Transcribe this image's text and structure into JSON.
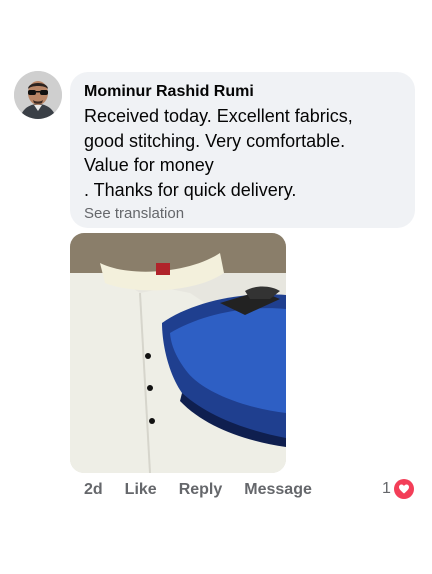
{
  "comment": {
    "author": "Mominur Rashid Rumi",
    "text_lines": [
      "Received today. Excellent fabrics,",
      "good stitching. Very comfortable.",
      "Value for money",
      ". Thanks for quick delivery."
    ],
    "see_translation": "See translation"
  },
  "actions": {
    "time": "2d",
    "like": "Like",
    "reply": "Reply",
    "message": "Message"
  },
  "reactions": {
    "count": "1",
    "icon": "heart-icon",
    "color": "#f33e58"
  },
  "colors": {
    "bubble": "#f0f2f5",
    "meta_text": "#65676b",
    "text": "#050505"
  }
}
